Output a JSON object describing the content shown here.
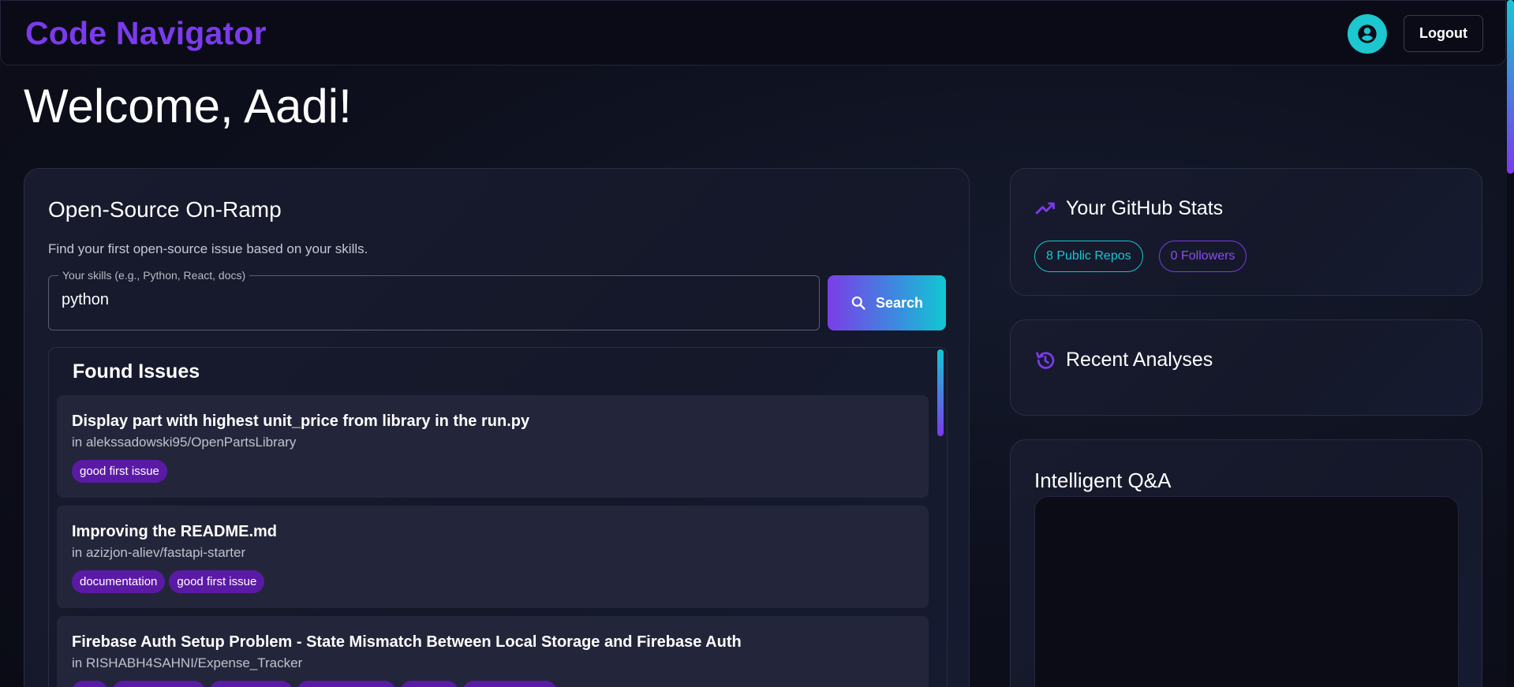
{
  "header": {
    "logo": "Code Navigator",
    "logout_label": "Logout"
  },
  "welcome": "Welcome, Aadi!",
  "onramp": {
    "title": "Open-Source On-Ramp",
    "description": "Find your first open-source issue based on your skills.",
    "skills_label": "Your skills (e.g., Python, React, docs)",
    "skills_value": "python",
    "search_label": "Search",
    "found_title": "Found Issues",
    "issues": [
      {
        "title": "Display part with highest unit_price from library in the run.py",
        "repo": "in alekssadowski95/OpenPartsLibrary",
        "tags": [
          "good first issue"
        ]
      },
      {
        "title": "Improving the README.md",
        "repo": "in azizjon-aliev/fastapi-starter",
        "tags": [
          "documentation",
          "good first issue"
        ]
      },
      {
        "title": "Firebase Auth Setup Problem - State Mismatch Between Local Storage and Firebase Auth",
        "repo": "in RISHABH4SAHNI/Expense_Tracker",
        "tags": []
      }
    ]
  },
  "stats": {
    "title": "Your GitHub Stats",
    "repos_chip": "8 Public Repos",
    "followers_chip": "0 Followers"
  },
  "recent": {
    "title": "Recent Analyses"
  },
  "qa": {
    "title": "Intelligent Q&A"
  },
  "colors": {
    "accent_purple": "#7c3aed",
    "accent_cyan": "#16c6d4",
    "tag_bg": "#5b1aa5"
  }
}
